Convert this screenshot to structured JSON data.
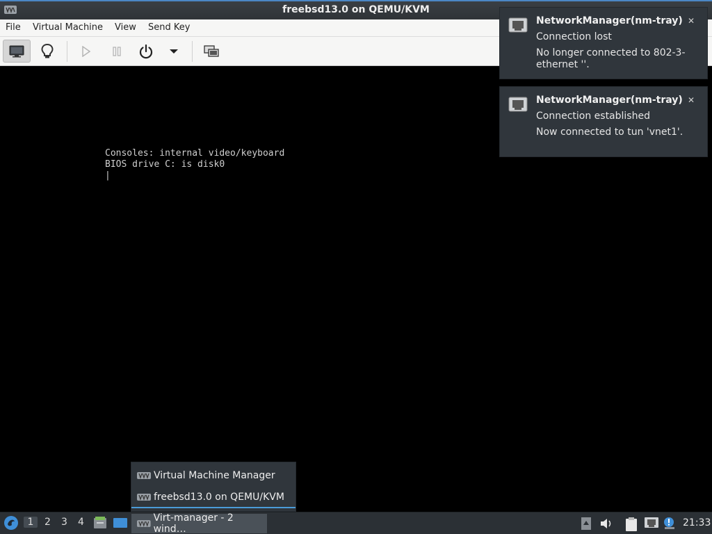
{
  "window": {
    "title": "freebsd13.0 on QEMU/KVM"
  },
  "menu": {
    "items": [
      "File",
      "Virtual Machine",
      "View",
      "Send Key"
    ]
  },
  "toolbar": {
    "buttons": [
      "console-button",
      "details-button",
      "run-button",
      "pause-button",
      "shutdown-button",
      "shutdown-menu-button",
      "snapshot-button"
    ]
  },
  "console": {
    "lines": [
      "Consoles: internal video/keyboard",
      "BIOS drive C: is disk0",
      "|"
    ]
  },
  "notifications": [
    {
      "app": "NetworkManager(nm-tray)",
      "summary": "Connection lost",
      "body": "No longer connected to 802-3-ethernet ''."
    },
    {
      "app": "NetworkManager(nm-tray)",
      "summary": "Connection established",
      "body": "Now connected to tun 'vnet1'."
    }
  ],
  "popup": {
    "items": [
      "Virtual Machine Manager",
      "freebsd13.0 on QEMU/KVM"
    ]
  },
  "taskbar": {
    "workspaces": [
      "1",
      "2",
      "3",
      "4"
    ],
    "task_label": "Virt-manager - 2 wind…",
    "clock": "21:33"
  },
  "colors": {
    "accent": "#4b9bd8",
    "panel": "#2b3035",
    "notification_bg": "#30363c"
  }
}
